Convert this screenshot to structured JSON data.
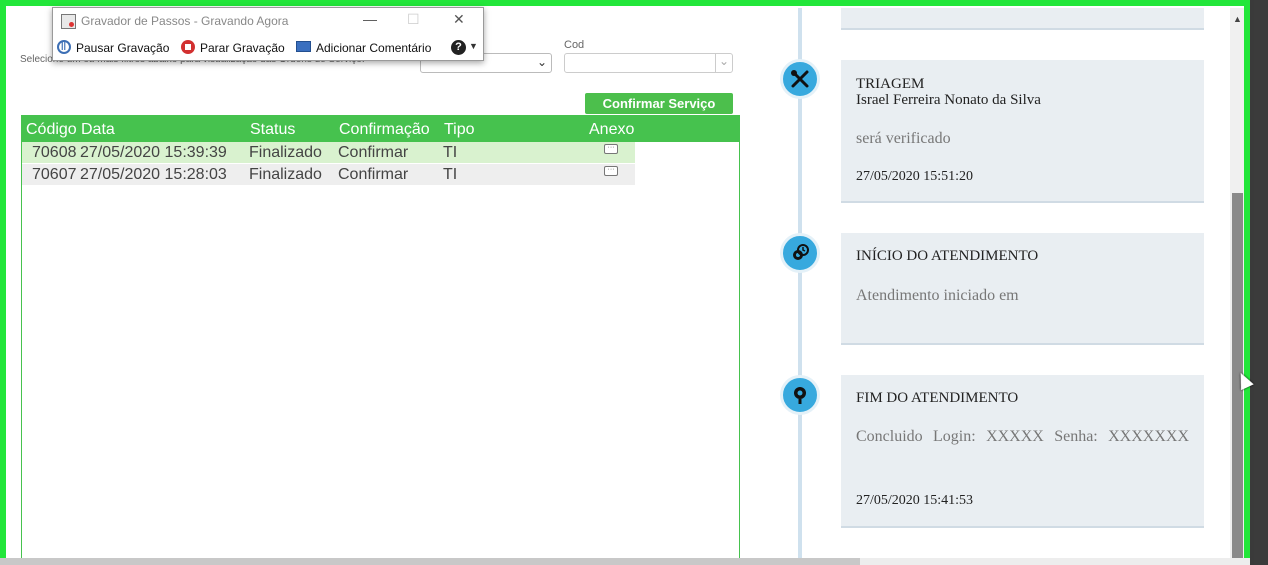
{
  "recorder": {
    "title": "Gravador de Passos - Gravando Agora",
    "pause_label": "Pausar Gravação",
    "stop_label": "Parar Gravação",
    "comment_label": "Adicionar Comentário",
    "help_icon": "?"
  },
  "filters": {
    "label": "Selecione um ou mais filtros abaixo para visualização das Ordens de Serviço:",
    "cod_label": "Cod",
    "select1_value": "",
    "select2_value": ""
  },
  "confirm_button": "Confirmar Serviço",
  "table": {
    "headers": [
      "Código",
      "Data",
      "Status",
      "Confirmação",
      "Tipo",
      "Anexo"
    ],
    "rows": [
      {
        "codigo": "70608",
        "data": "27/05/2020 15:39:39",
        "status": "Finalizado",
        "confirmacao": "Confirmar",
        "tipo": "TI"
      },
      {
        "codigo": "70607",
        "data": "27/05/2020 15:28:03",
        "status": "Finalizado",
        "confirmacao": "Confirmar",
        "tipo": "TI"
      }
    ]
  },
  "timeline": [
    {
      "title": "TRIAGEM",
      "subtitle": "Israel Ferreira Nonato da Silva",
      "body": "será verificado",
      "date": "27/05/2020 15:51:20",
      "icon": "tools-icon"
    },
    {
      "title": "INÍCIO DO ATENDIMENTO",
      "subtitle": "",
      "body": "Atendimento iniciado em",
      "date": "",
      "icon": "gear-clock-icon"
    },
    {
      "title": "FIM DO ATENDIMENTO",
      "subtitle": "",
      "body": "Concluido Login: XXXXX Senha: XXXXXXX",
      "date": "27/05/2020 15:41:53",
      "icon": "gear-check-icon"
    }
  ],
  "colors": {
    "frame": "#22e63a",
    "grid_header": "#46c24e",
    "button": "#4cbf4c",
    "timeline_icon": "#37a9de",
    "card": "#e9eef2"
  }
}
